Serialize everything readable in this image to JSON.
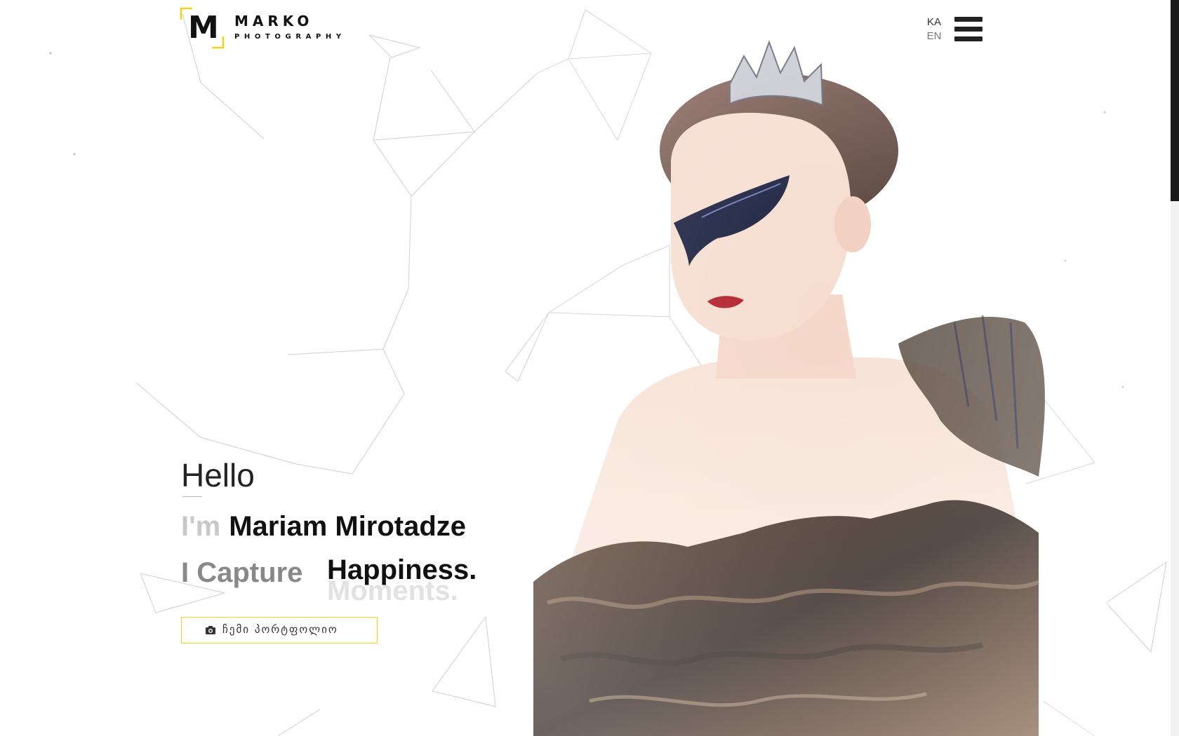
{
  "brand": {
    "logo_letter": "M",
    "name": "MARKO",
    "subtitle": "PHOTOGRAPHY",
    "accent_color": "#f0d419"
  },
  "header": {
    "languages": [
      "KA",
      "EN"
    ],
    "menu_icon": "hamburger-icon"
  },
  "hero": {
    "greeting": "Hello",
    "intro_prefix": "I'm",
    "person_name": "Mariam Mirotadze",
    "capture_prefix": "I Capture",
    "rotating_words": [
      "Happiness.",
      "Moments."
    ],
    "cta_label": "ჩემი პორტფოლიო",
    "cta_icon": "camera-icon"
  },
  "colors": {
    "text_dark": "#111111",
    "text_muted": "#888888",
    "text_faint": "#c8c8c8",
    "button_border": "#f0d419"
  }
}
